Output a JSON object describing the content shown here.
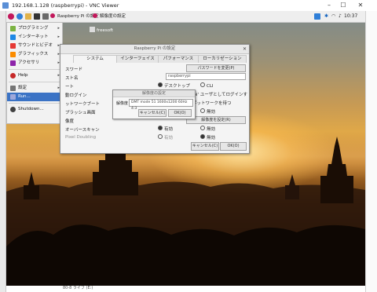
{
  "vnc_window": {
    "title": "192.168.1.128 (raspberrypi) - VNC Viewer",
    "min": "–",
    "max": "☐",
    "close": "✕"
  },
  "taskbar": {
    "tasks": [
      "Raspberry Pi の設定",
      "解像度の設定"
    ],
    "clock": "10:37"
  },
  "desktop_file": "freesoft",
  "start_menu": {
    "items": [
      {
        "label": "プログラミング",
        "arrow": "▸",
        "icon": "code-icon",
        "color": "#7cb342"
      },
      {
        "label": "インターネット",
        "arrow": "▸",
        "icon": "globe-icon",
        "color": "#1e88e5"
      },
      {
        "label": "サウンドとビデオ",
        "arrow": "▸",
        "icon": "media-icon",
        "color": "#e53935"
      },
      {
        "label": "グラフィックス",
        "arrow": "▸",
        "icon": "graphics-icon",
        "color": "#fb8c00"
      },
      {
        "label": "アクセサリ",
        "arrow": "▸",
        "icon": "accessories-icon",
        "color": "#8e24aa"
      },
      {
        "label": "Help",
        "arrow": "▸",
        "icon": "help-icon",
        "color": "#c62828"
      },
      {
        "label": "設定",
        "arrow": "▸",
        "icon": "settings-icon",
        "color": "#757575"
      },
      {
        "label": "Run...",
        "arrow": "",
        "icon": "run-icon",
        "color": "#5c6bc0"
      },
      {
        "label": "Shutdown...",
        "arrow": "",
        "icon": "shutdown-icon",
        "color": "#424242"
      }
    ]
  },
  "dialog": {
    "title": "Raspberry Pi の設定",
    "close": "✕",
    "tabs": [
      "システム",
      "インターフェイス",
      "パフォーマンス",
      "ローカリゼーション"
    ],
    "rows": {
      "password_label": "スワード",
      "password_button": "パスワードを変更(P)",
      "hostname_label": "スト名",
      "hostname_value": "raspberrypi",
      "boot_label": "ート",
      "boot_desktop": "デスクトップ",
      "boot_cli": "CLI",
      "autologin_label": "動ログイン",
      "autologin_text": "'pi' ユーザとしてログインする",
      "netboot_label": "ットワークブート",
      "netboot_text": "ネットワークを待つ",
      "splash_label": "プラッシュ画面",
      "splash_disable": "無効",
      "resolution_label": "像度",
      "resolution_button": "解像度を設定(R)",
      "overscan_label": "オーバースキャン",
      "overscan_enable": "有効",
      "overscan_disable": "無効",
      "pixel_label": "Pixel Doubling",
      "pixel_enable": "有効",
      "pixel_disable": "無効",
      "cancel": "キャンセル(C)",
      "ok": "OK(O)"
    }
  },
  "resolution_dialog": {
    "title": "解像度の設定",
    "label": "解像度",
    "selected": "DMT mode 51 1600x1200 60Hz 4:3",
    "cancel": "キャンセル(C)",
    "ok": "OK(O)"
  },
  "status": "80-8 ライブ (E:)"
}
